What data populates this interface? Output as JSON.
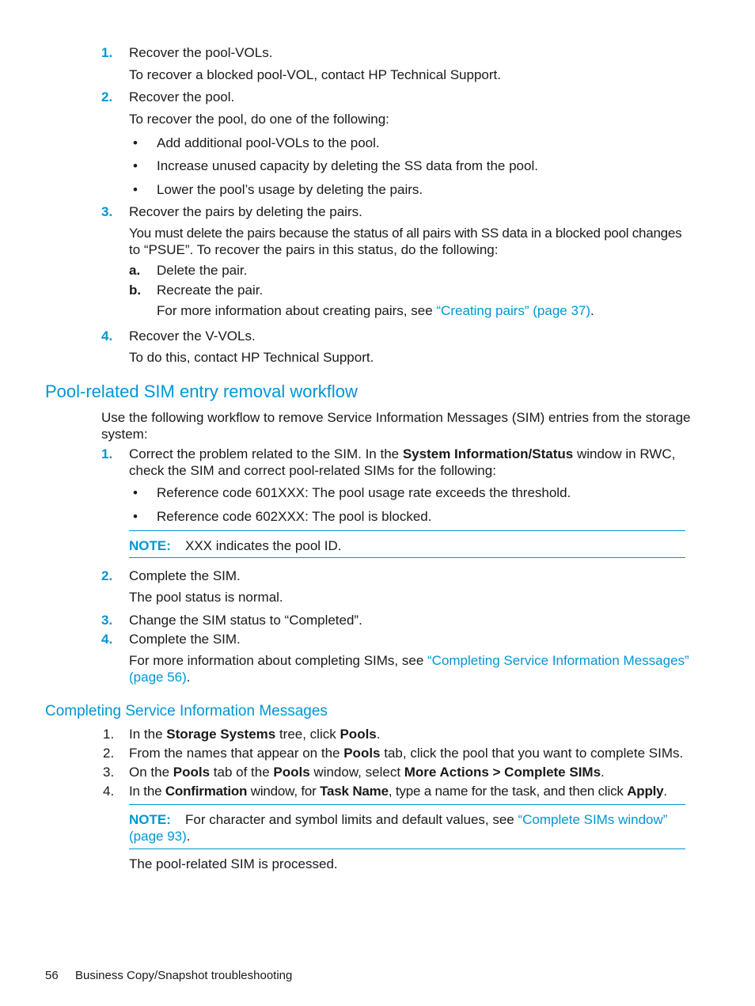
{
  "recovery_steps": [
    {
      "num": "1.",
      "title": "Recover the pool-VOLs.",
      "detail": "To recover a blocked pool-VOL, contact HP Technical Support."
    },
    {
      "num": "2.",
      "title": "Recover the pool.",
      "detail": "To recover the pool, do one of the following:",
      "bullets": [
        "Add additional pool-VOLs to the pool.",
        "Increase unused capacity by deleting the SS data from the pool.",
        "Lower the pool’s usage by deleting the pairs."
      ]
    },
    {
      "num": "3.",
      "title": "Recover the pairs by deleting the pairs.",
      "detail_line1": "You must delete the pairs because the status of all pairs with SS data in a blocked pool changes",
      "detail_line2": "to “PSUE”. To recover the pairs in this status, do the following:",
      "substeps": [
        {
          "num": "a.",
          "text": "Delete the pair."
        },
        {
          "num": "b.",
          "text": "Recreate the pair."
        }
      ],
      "more_prefix": "For more information about creating pairs, see ",
      "more_link": "“Creating pairs” (page 37)",
      "more_suffix": "."
    },
    {
      "num": "4.",
      "title": "Recover the V-VOLs.",
      "detail": "To do this, contact HP Technical Support."
    }
  ],
  "section": {
    "title": "Pool-related SIM entry removal workflow",
    "intro_line1": "Use the following workflow to remove Service Information Messages (SIM) entries from the storage",
    "intro_line2": "system:",
    "steps": [
      {
        "num": "1.",
        "pre": "Correct the problem related to the SIM. In the ",
        "bold": "System Information/Status",
        "post": " window in RWC,",
        "line2": "check the SIM and correct pool-related SIMs for the following:",
        "bullets": [
          "Reference code 601XXX: The pool usage rate exceeds the threshold.",
          "Reference code 602XXX: The pool is blocked."
        ],
        "note_label": "NOTE:",
        "note_text": "XXX indicates the pool ID."
      },
      {
        "num": "2.",
        "title": "Complete the SIM.",
        "detail": "The pool status is normal."
      },
      {
        "num": "3.",
        "title": "Change the SIM status to “Completed”."
      },
      {
        "num": "4.",
        "title": "Complete the SIM.",
        "more_prefix": "For more information about completing SIMs, see ",
        "more_link_line1": "“Completing Service Information Messages”",
        "more_link_line2": "(page 56)",
        "more_suffix": "."
      }
    ]
  },
  "subsection": {
    "title": "Completing Service Information Messages",
    "steps": [
      {
        "num": "1.",
        "parts": [
          "In the ",
          "Storage Systems",
          " tree, click ",
          "Pools",
          "."
        ]
      },
      {
        "num": "2.",
        "parts": [
          "From the names that appear on the ",
          "Pools",
          " tab, click the pool that you want to complete SIMs."
        ]
      },
      {
        "num": "3.",
        "parts": [
          "On the ",
          "Pools",
          " tab of the ",
          "Pools",
          " window, select ",
          "More Actions > Complete SIMs",
          "."
        ]
      },
      {
        "num": "4.",
        "parts": [
          "In the ",
          "Confirmation",
          " window, for ",
          "Task Name",
          ", type a name for the task, and then click ",
          "Apply",
          "."
        ]
      }
    ],
    "note_label": "NOTE:",
    "note_text": "For character and symbol limits and default values, see ",
    "note_link_line1": "“Complete SIMs window”",
    "note_link_line2": "(page 93)",
    "note_suffix": ".",
    "result": "The pool-related SIM is processed."
  },
  "footer": {
    "page_number": "56",
    "chapter": "Business Copy/Snapshot troubleshooting"
  }
}
